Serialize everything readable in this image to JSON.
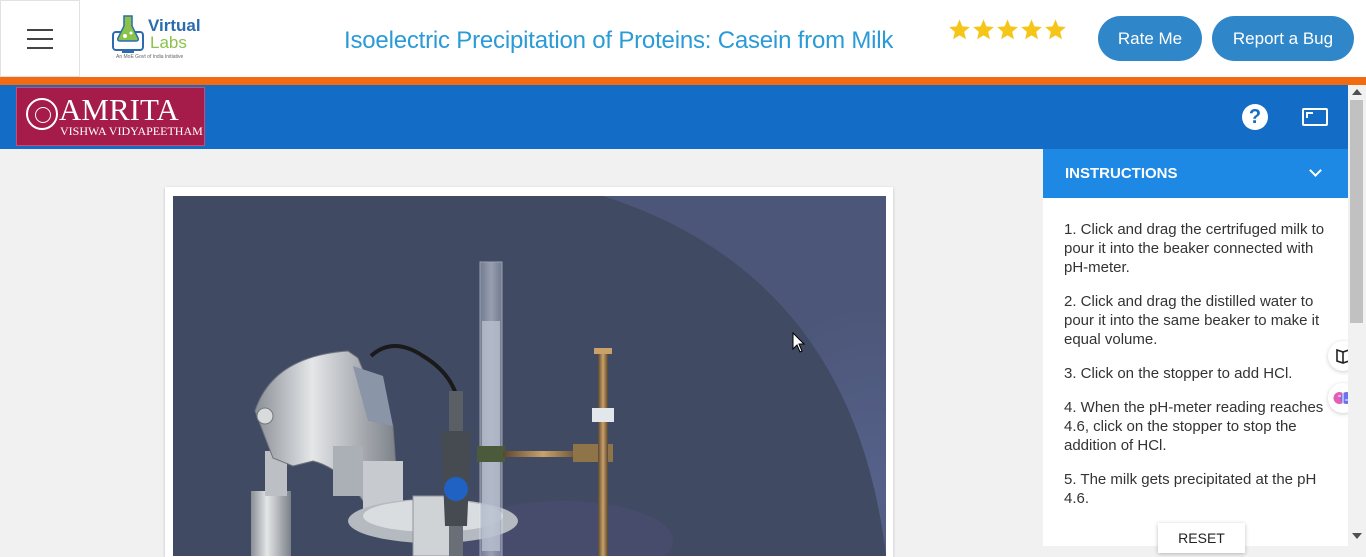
{
  "topbar": {
    "logo_line1": "Virtual",
    "logo_line2": "Labs",
    "logo_tagline": "An MoE Govt of India Initiative",
    "page_title": "Isoelectric Precipitation of Proteins: Casein from Milk",
    "rating_stars": 5,
    "rate_button": "Rate Me",
    "bug_button": "Report a Bug",
    "star_color": "#f5c518"
  },
  "header": {
    "brand_name": "AMRITA",
    "brand_sub": "VISHWA VIDYAPEETHAM",
    "help_icon": "?",
    "accent_color": "#136cc5",
    "bar_color": "#f36b10"
  },
  "instructions": {
    "title": "INSTRUCTIONS",
    "steps": [
      "1. Click and drag the certrifuged milk to pour it into the beaker connected with pH-meter.",
      "2. Click and drag the distilled water to pour it into the same beaker to make it equal volume.",
      "3. Click on the stopper to add HCl.",
      "4. When the pH-meter reading reaches 4.6, click on the stopper to stop the addition of HCl.",
      "5. The milk gets precipitated at the pH 4.6."
    ],
    "reset_button": "RESET"
  }
}
